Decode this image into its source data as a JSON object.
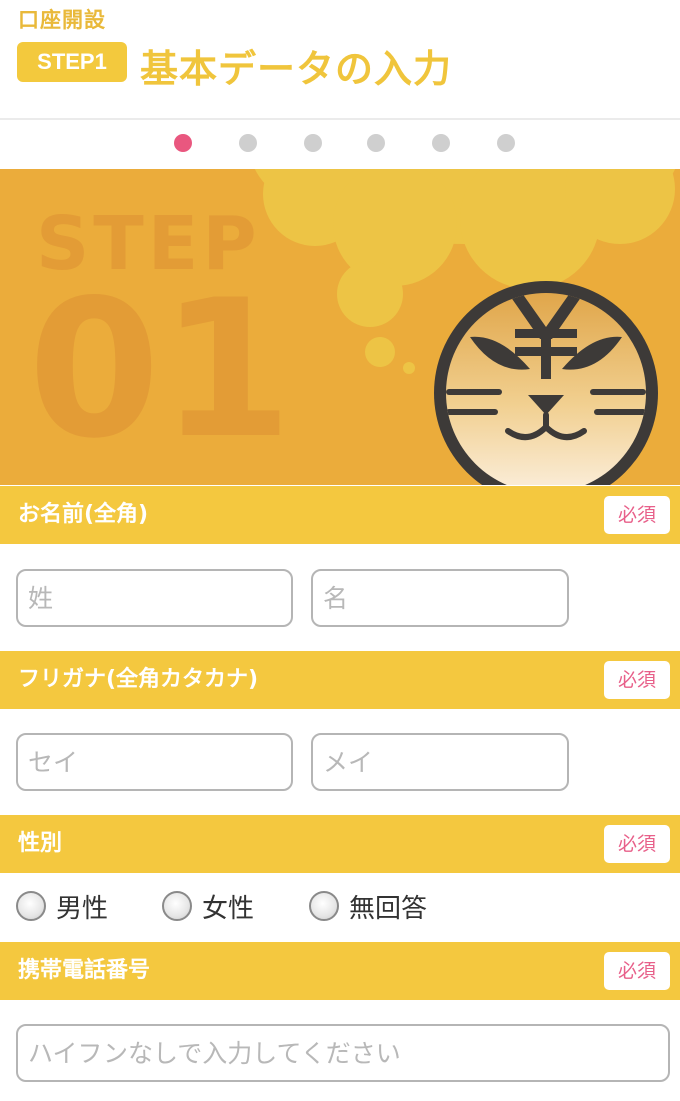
{
  "header": {
    "breadcrumb": "口座開設",
    "step_badge": "STEP1",
    "title": "基本データの入力"
  },
  "progress": {
    "total_steps": 6,
    "current_step": 1
  },
  "hero": {
    "step_word": "STEP",
    "step_number": "01"
  },
  "sections": {
    "name": {
      "label": "お名前(全角)",
      "required": "必須",
      "last_placeholder": "姓",
      "first_placeholder": "名"
    },
    "furigana": {
      "label": "フリガナ(全角カタカナ)",
      "required": "必須",
      "last_placeholder": "セイ",
      "first_placeholder": "メイ"
    },
    "gender": {
      "label": "性別",
      "required": "必須",
      "options": [
        "男性",
        "女性",
        "無回答"
      ]
    },
    "phone": {
      "label": "携帯電話番号",
      "required": "必須",
      "placeholder": "ハイフンなしで入力してください"
    }
  },
  "colors": {
    "accent_yellow": "#f4c83f",
    "hero_orange": "#ebac3b",
    "active_dot": "#e9577f",
    "inactive_dot": "#cfcfcf",
    "required_text": "#e8608a"
  },
  "icons": {
    "mascot": "tiger-yen-face-icon"
  }
}
